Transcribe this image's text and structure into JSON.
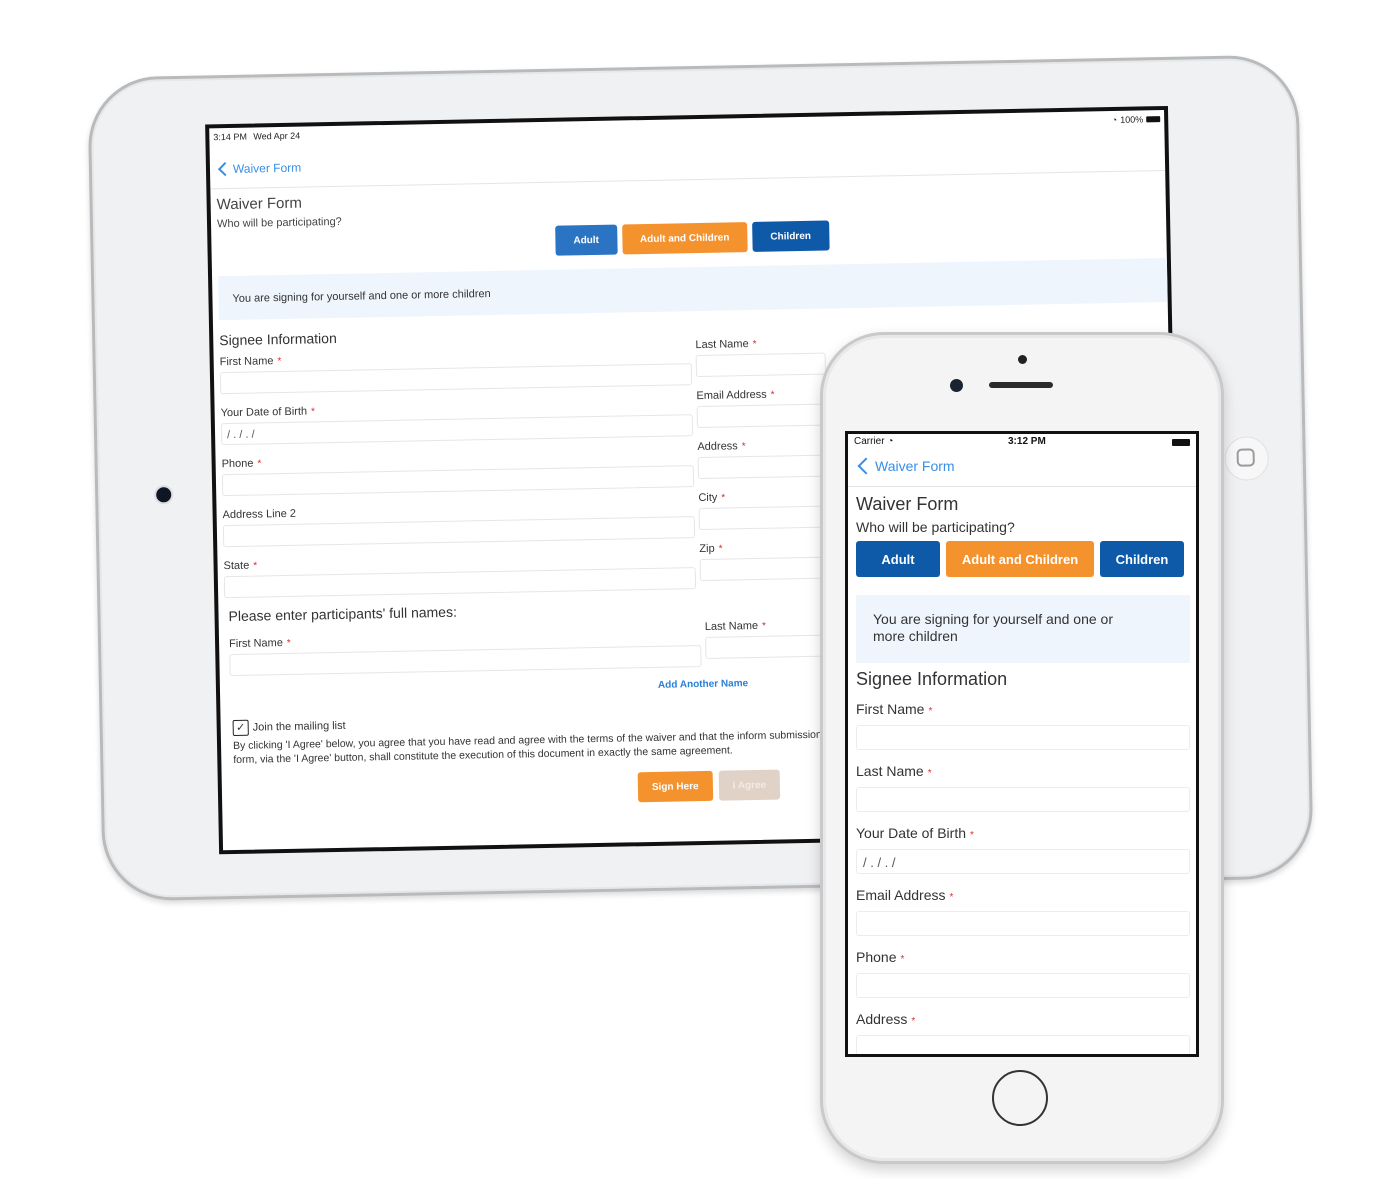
{
  "tablet": {
    "status_bar": {
      "time": "3:14 PM",
      "date": "Wed Apr 24",
      "battery": "100%"
    },
    "nav": {
      "back_label": "Waiver Form"
    },
    "form": {
      "title": "Waiver Form",
      "question": "Who will be participating?",
      "participant_options": [
        {
          "label": "Adult",
          "color": "#2b74c4"
        },
        {
          "label": "Adult and Children",
          "color": "#f4922e",
          "selected": true
        },
        {
          "label": "Children",
          "color": "#0e5aa8"
        }
      ],
      "info_message": "You are signing for yourself and one or more children",
      "signee_section": "Signee Information",
      "left_fields": [
        {
          "label": "First Name",
          "required": true,
          "value": ""
        },
        {
          "label": "Your Date of Birth",
          "required": true,
          "value": "/ . / . /"
        },
        {
          "label": "Phone",
          "required": true,
          "value": ""
        },
        {
          "label": "Address Line 2",
          "required": false,
          "value": ""
        },
        {
          "label": "State",
          "required": true,
          "value": ""
        }
      ],
      "right_fields": [
        {
          "label": "Last Name",
          "required": true,
          "value": ""
        },
        {
          "label": "Email Address",
          "required": true,
          "value": ""
        },
        {
          "label": "Address",
          "required": true,
          "value": ""
        },
        {
          "label": "City",
          "required": true,
          "value": ""
        },
        {
          "label": "Zip",
          "required": true,
          "value": ""
        }
      ],
      "participants_heading": "Please enter participants' full names:",
      "participant_first_label": "First Name",
      "participant_last_label": "Last Name",
      "add_another_label": "Add Another Name",
      "mailing_list_label": "Join the mailing list",
      "mailing_list_checked": true,
      "legal_text": "By clicking 'I Agree' below, you agree that you have read and agree with the terms of the waiver and that the inform submission of this form, via the 'I Agree' button, shall constitute the execution of this document in exactly the same agreement.",
      "sign_button": "Sign Here",
      "agree_button": "I Agree",
      "required_marker": "*"
    }
  },
  "phone": {
    "status_bar": {
      "carrier": "Carrier",
      "time": "3:12 PM"
    },
    "nav": {
      "back_label": "Waiver Form"
    },
    "form": {
      "title": "Waiver Form",
      "question": "Who will be participating?",
      "participant_options": [
        {
          "label": "Adult"
        },
        {
          "label": "Adult and Children",
          "selected": true
        },
        {
          "label": "Children"
        }
      ],
      "info_message": "You are signing for yourself and one or more children",
      "signee_section": "Signee Information",
      "fields": [
        {
          "label": "First Name",
          "required": true,
          "value": ""
        },
        {
          "label": "Last Name",
          "required": true,
          "value": ""
        },
        {
          "label": "Your Date of Birth",
          "required": true,
          "value": "/ . / . /"
        },
        {
          "label": "Email Address",
          "required": true,
          "value": ""
        },
        {
          "label": "Phone",
          "required": true,
          "value": ""
        },
        {
          "label": "Address",
          "required": true,
          "value": ""
        }
      ],
      "required_marker": "*"
    }
  }
}
